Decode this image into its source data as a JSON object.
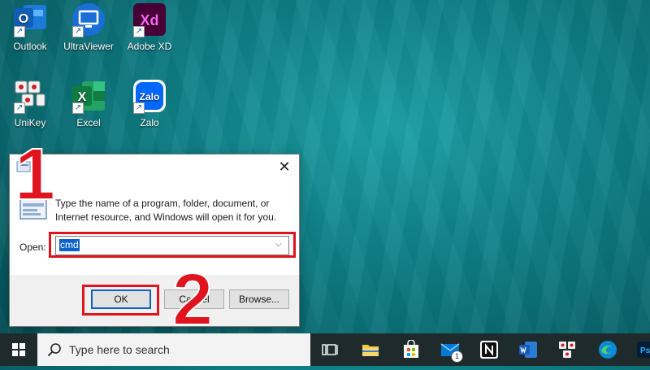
{
  "desktop": {
    "icons": [
      {
        "label": "Outlook",
        "icon": "outlook-icon",
        "glyph": "O"
      },
      {
        "label": "UltraViewer",
        "icon": "ultraviewer-icon"
      },
      {
        "label": "Adobe XD",
        "icon": "adobe-xd-icon",
        "glyph": "Xd"
      },
      {
        "label": "UniKey",
        "icon": "unikey-icon"
      },
      {
        "label": "Excel",
        "icon": "excel-icon",
        "glyph": "X"
      },
      {
        "label": "Zalo",
        "icon": "zalo-icon",
        "glyph": "Zalo"
      }
    ]
  },
  "run_dialog": {
    "description": "Type the name of a program, folder, document, or Internet resource, and Windows will open it for you.",
    "open_label": "Open:",
    "open_value": "cmd",
    "ok_label": "OK",
    "cancel_label": "Cancel",
    "browse_label": "Browse...",
    "close_glyph": "✕"
  },
  "annotations": {
    "step1": "1",
    "step2": "2",
    "highlight_color": "#e0141e"
  },
  "taskbar": {
    "search_placeholder": "Type here to search",
    "mail_badge": "1",
    "icons": [
      "windows-start-icon",
      "task-view-icon",
      "file-explorer-icon",
      "microsoft-store-icon",
      "mail-icon",
      "notion-icon",
      "word-icon",
      "unikey-taskbar-icon",
      "edge-icon",
      "photoshop-icon"
    ]
  }
}
